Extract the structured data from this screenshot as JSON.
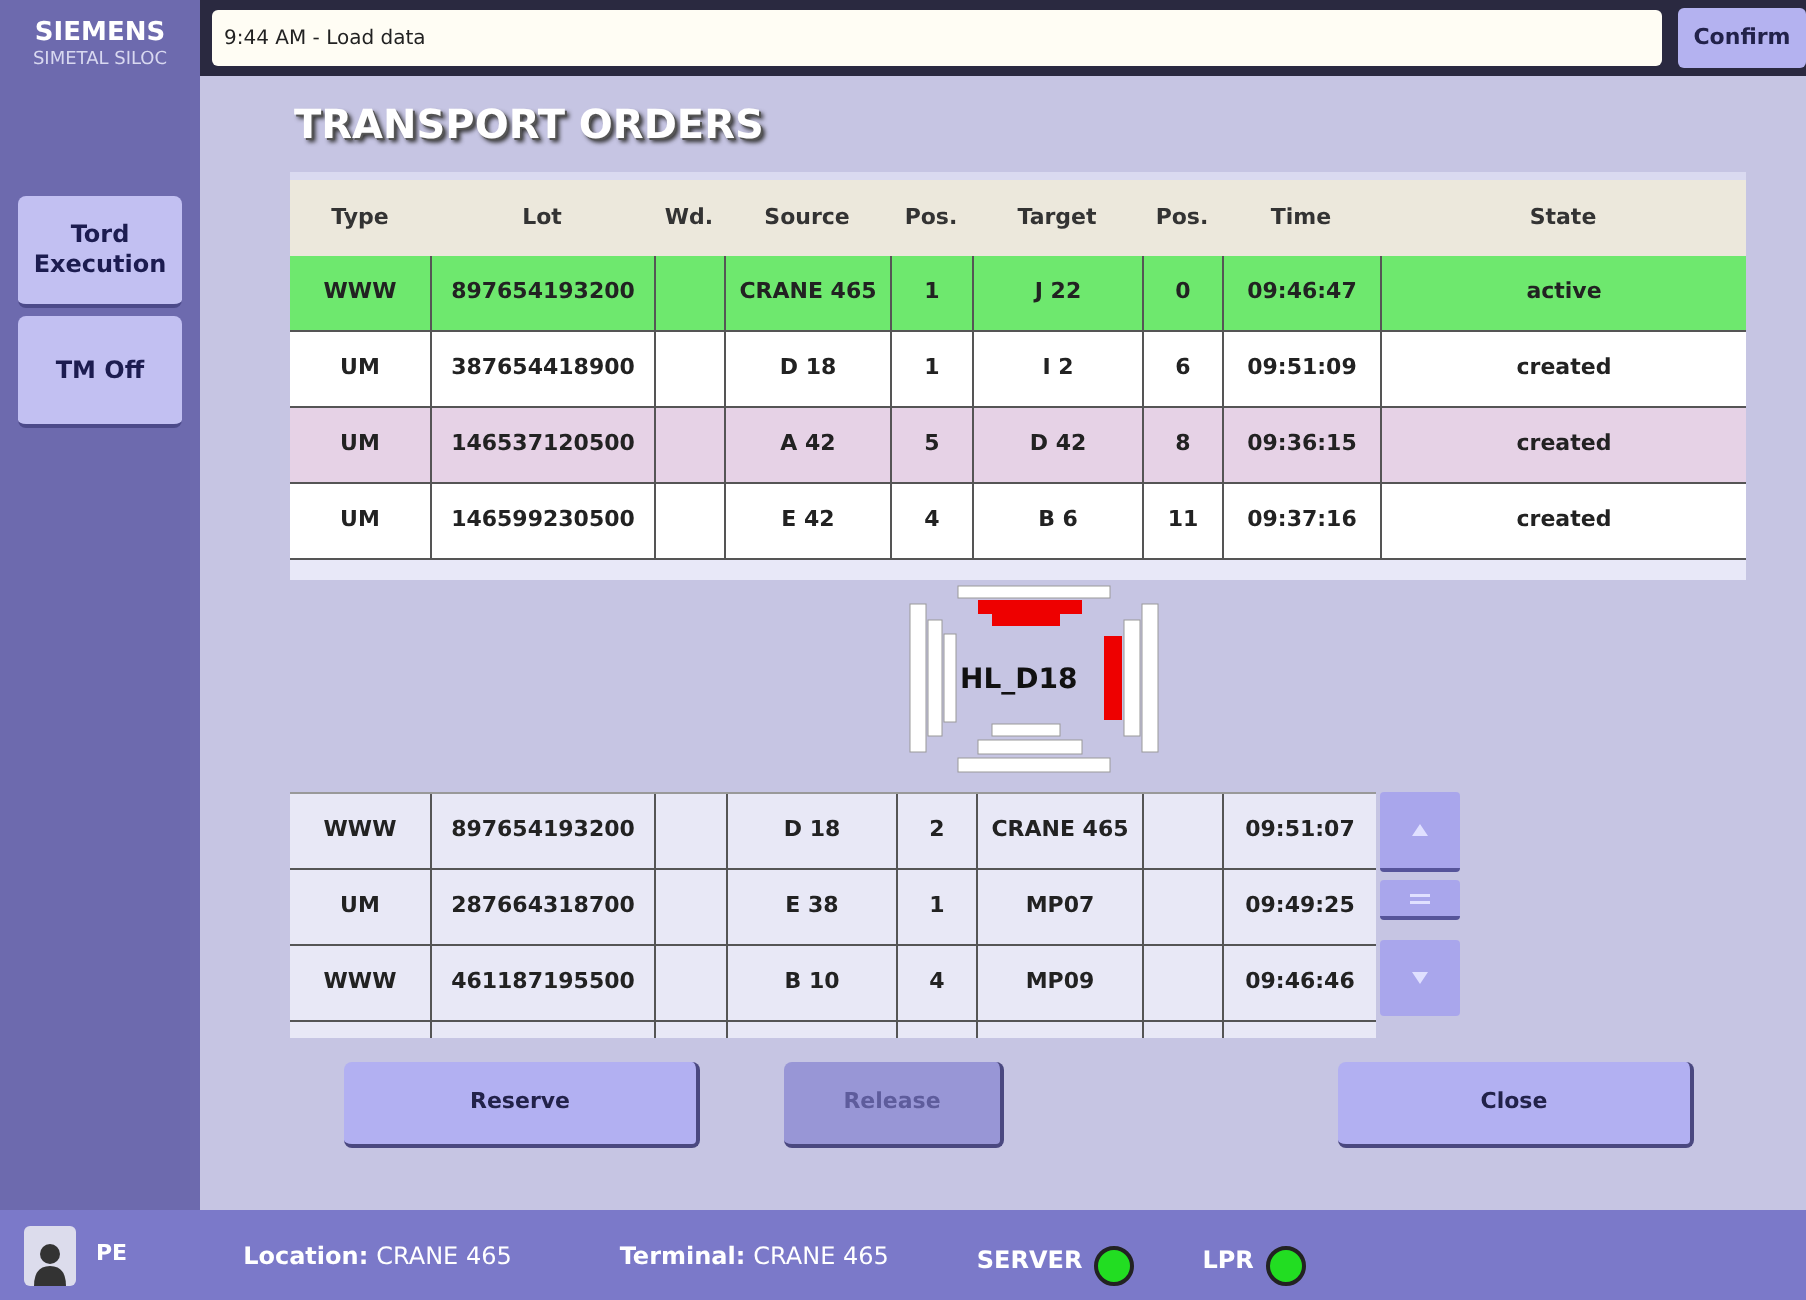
{
  "brand": {
    "name": "SIEMENS",
    "product": "SIMETAL SILOC"
  },
  "message": {
    "value": "9:44 AM - Load data"
  },
  "confirm_button": "Confirm",
  "sidebar": {
    "items": [
      {
        "label": "Tord Execution",
        "selected": false
      },
      {
        "label": "TM Off",
        "selected": false
      }
    ]
  },
  "title": "TRANSPORT ORDERS",
  "orders": {
    "columns": [
      "Type",
      "Lot",
      "Wd.",
      "Source",
      "Pos.",
      "Target",
      "Pos.",
      "Time",
      "State"
    ],
    "rows": [
      {
        "color": "#6ee86e",
        "cells": [
          "WWW",
          "897654193200",
          "",
          "CRANE 465",
          "1",
          "J 22",
          "0",
          "09:46:47",
          "active"
        ]
      },
      {
        "color": "#ffffff",
        "cells": [
          "UM",
          "387654418900",
          "",
          "D 18",
          "1",
          "I 2",
          "6",
          "09:51:09",
          "created"
        ]
      },
      {
        "color": "#e6d2e6",
        "cells": [
          "UM",
          "146537120500",
          "",
          "A 42",
          "5",
          "D 42",
          "8",
          "09:36:15",
          "created"
        ]
      },
      {
        "color": "#ffffff",
        "cells": [
          "UM",
          "146599230500",
          "",
          "E 42",
          "4",
          "B 6",
          "11",
          "09:37:16",
          "created"
        ]
      }
    ]
  },
  "crane": {
    "label": "HL_D18"
  },
  "queue": {
    "rows": [
      {
        "cells": [
          "WWW",
          "897654193200",
          "",
          "D 18",
          "2",
          "CRANE 465",
          "",
          "09:51:07"
        ]
      },
      {
        "cells": [
          "UM",
          "287664318700",
          "",
          "E 38",
          "1",
          "MP07",
          "",
          "09:49:25"
        ]
      },
      {
        "cells": [
          "WWW",
          "461187195500",
          "",
          "B 10",
          "4",
          "MP09",
          "",
          "09:46:46"
        ]
      }
    ]
  },
  "buttons": [
    {
      "label": "Reserve",
      "disabled": false
    },
    {
      "label": "Release",
      "disabled": true
    },
    {
      "label": "Close",
      "disabled": false
    }
  ],
  "status_bar": {
    "user": "PE",
    "location_label": "Location:",
    "location": "CRANE 465",
    "terminal_label": "Terminal:",
    "terminal": "CRANE 465",
    "indicators": [
      {
        "label": "SERVER",
        "on": true
      },
      {
        "label": "LPR",
        "on": true
      }
    ]
  }
}
